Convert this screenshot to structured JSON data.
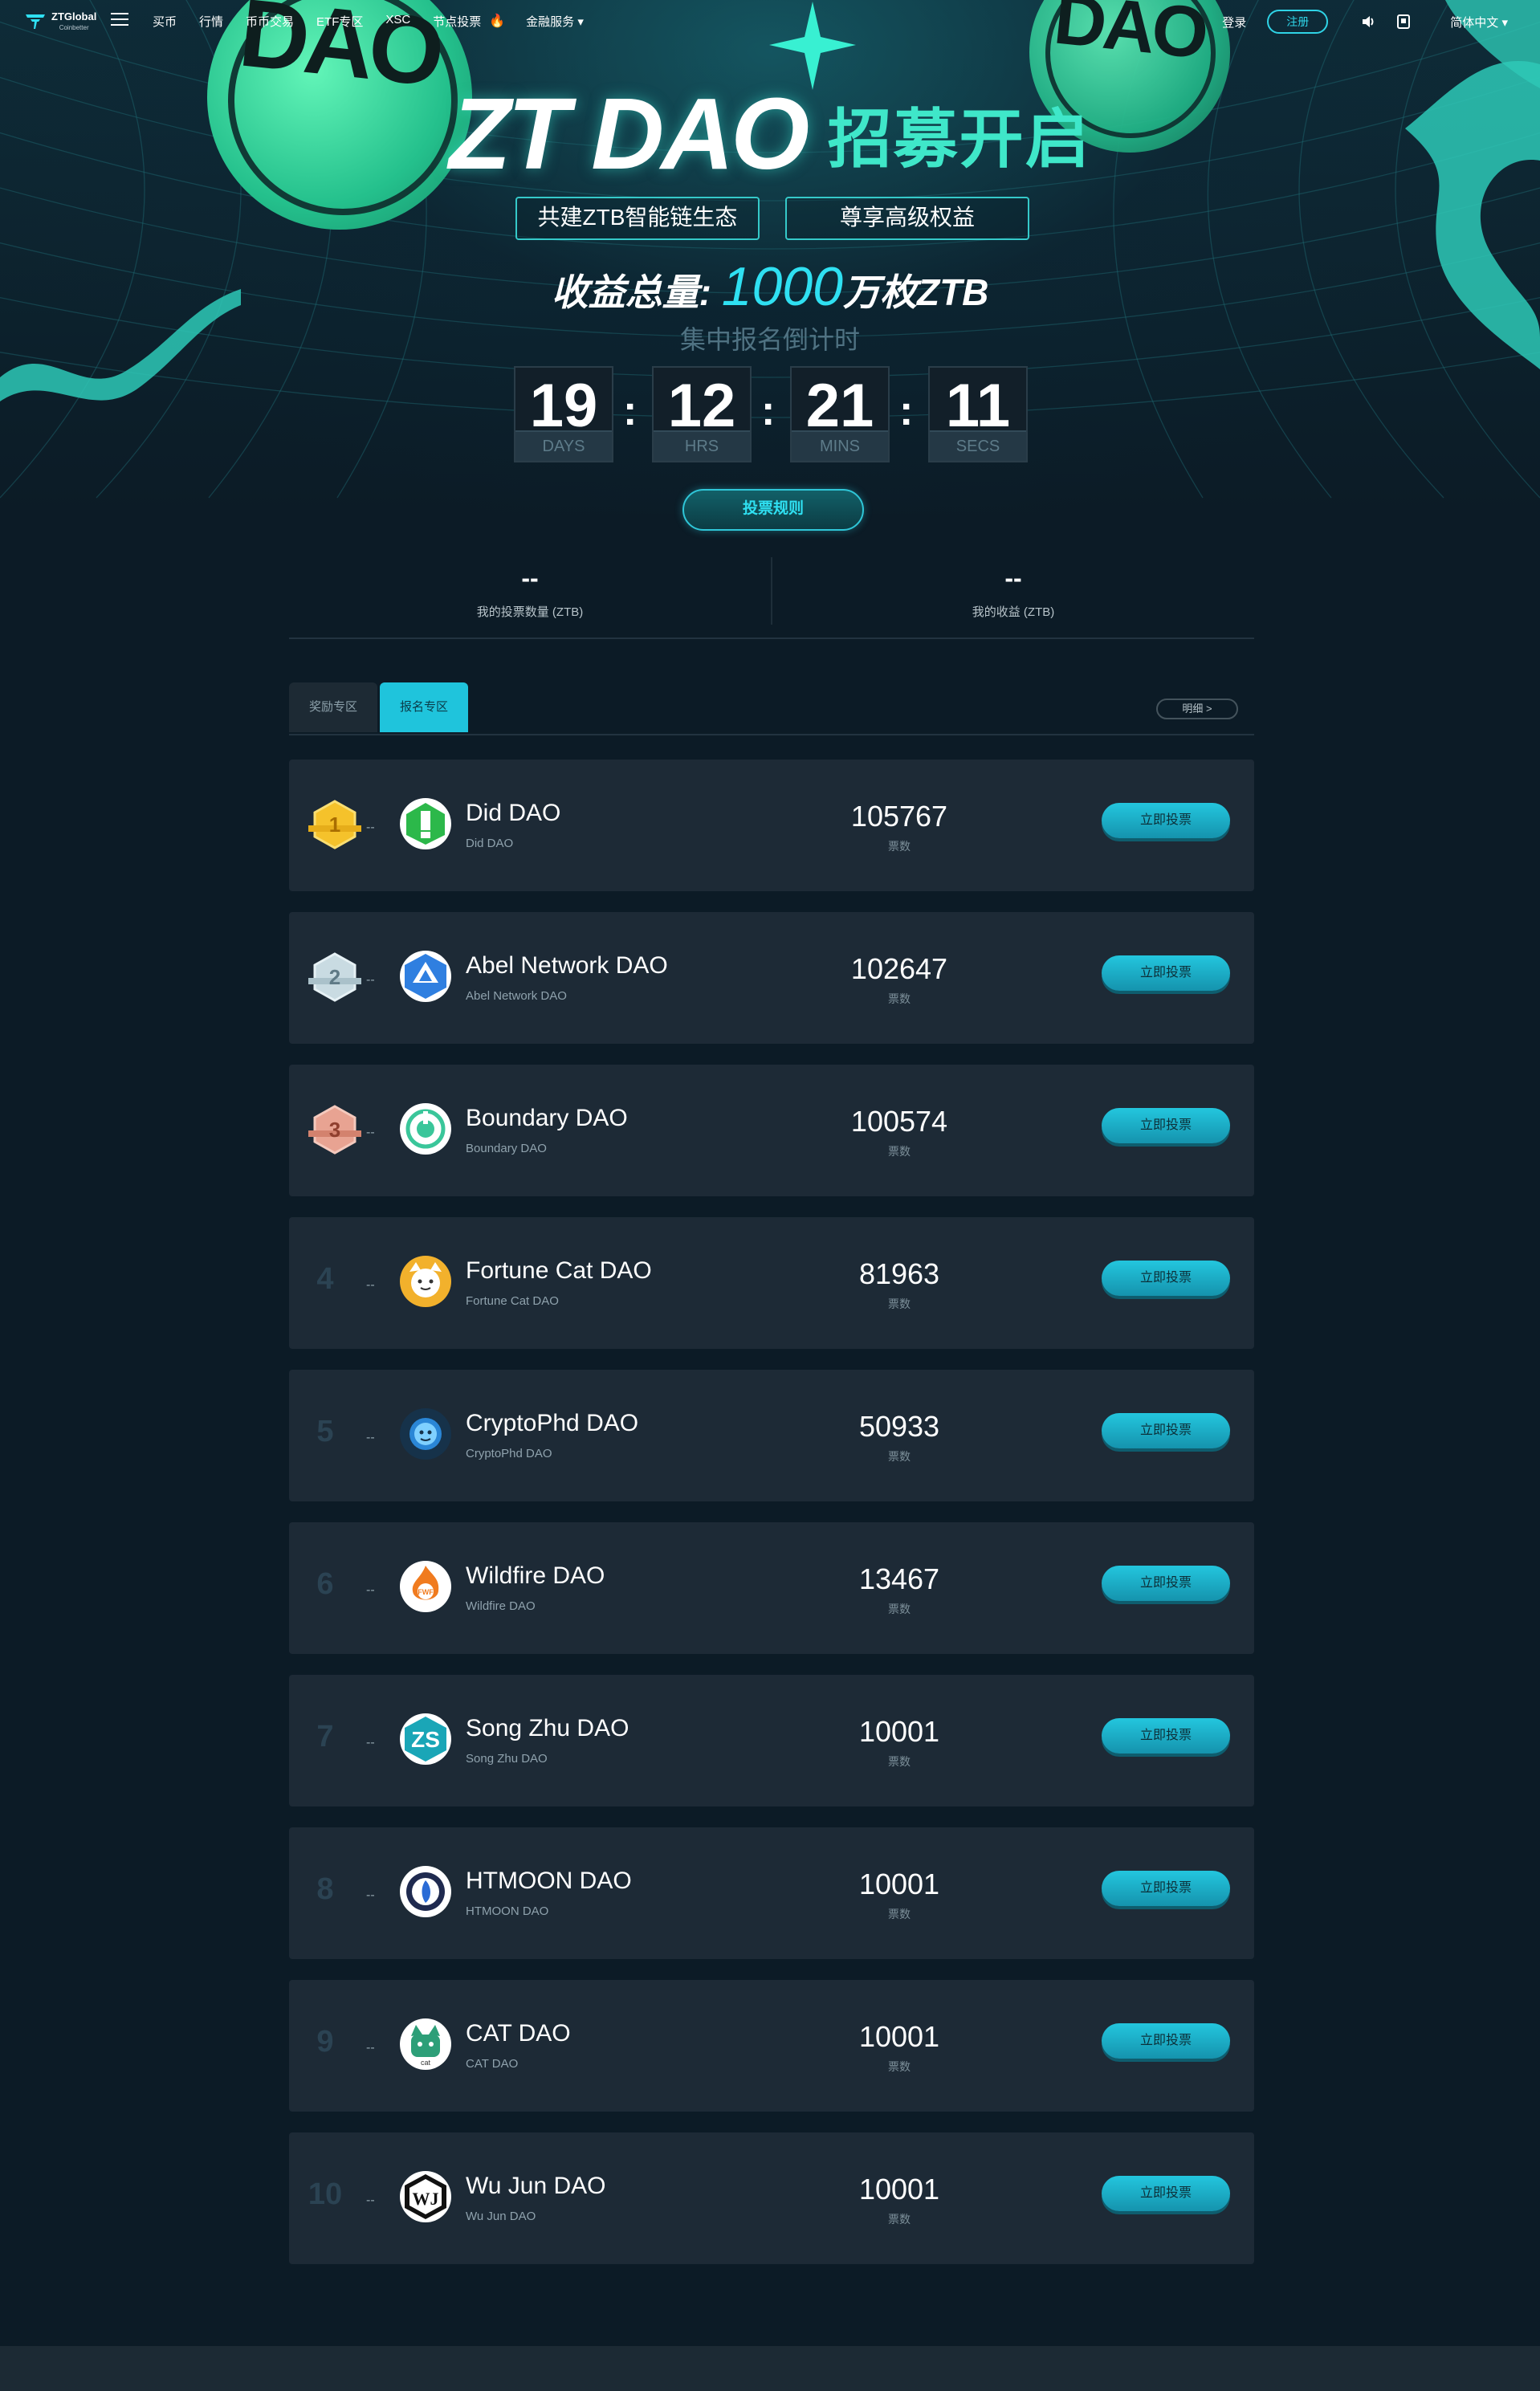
{
  "nav": {
    "logo_text": "ZTGlobal",
    "logo_sub": "Coinbetter",
    "links": [
      "买币",
      "行情",
      "币币交易",
      "ETF专区",
      "XSC",
      "节点投票"
    ],
    "fire_icon": "fire-icon",
    "finance_label": "金融服务",
    "login_label": "登录",
    "register_label": "注册",
    "language_label": "简体中文"
  },
  "hero": {
    "coin_text": "DAO",
    "title_en": "ZT DAO",
    "title_cn": "招募开启",
    "tag1": "共建ZTB智能链生态",
    "tag2": "尊享高级权益",
    "total_prefix": "收益总量:",
    "total_value": "1000",
    "total_suffix": "万枚ZTB",
    "countdown_label": "集中报名倒计时",
    "countdown": [
      {
        "value": "19",
        "unit": "DAYS"
      },
      {
        "value": "12",
        "unit": "HRS"
      },
      {
        "value": "21",
        "unit": "MINS"
      },
      {
        "value": "11",
        "unit": "SECS"
      }
    ],
    "separator": ":",
    "rules_button": "投票规则"
  },
  "stats": {
    "my_votes_value": "--",
    "my_votes_label": "我的投票数量 (ZTB)",
    "my_income_value": "--",
    "my_income_label": "我的收益 (ZTB)"
  },
  "tabs": {
    "items": [
      "奖励专区",
      "报名专区"
    ],
    "active": 1,
    "detail_label": "明细 >"
  },
  "list": {
    "votes_unit": "票数",
    "vote_button": "立即投票",
    "dash": "--",
    "rows": [
      {
        "rank": "1",
        "name": "Did DAO",
        "sub": "Did DAO",
        "votes": "105767",
        "icon": "did-dao-logo-icon"
      },
      {
        "rank": "2",
        "name": "Abel Network DAO",
        "sub": "Abel Network DAO",
        "votes": "102647",
        "icon": "abel-network-logo-icon"
      },
      {
        "rank": "3",
        "name": "Boundary DAO",
        "sub": "Boundary DAO",
        "votes": "100574",
        "icon": "boundary-logo-icon"
      },
      {
        "rank": "4",
        "name": "Fortune Cat DAO",
        "sub": "Fortune Cat DAO",
        "votes": "81963",
        "icon": "fortune-cat-logo-icon"
      },
      {
        "rank": "5",
        "name": "CryptoPhd DAO",
        "sub": "CryptoPhd DAO",
        "votes": "50933",
        "icon": "cryptophd-logo-icon"
      },
      {
        "rank": "6",
        "name": "Wildfire DAO",
        "sub": "Wildfire DAO",
        "votes": "13467",
        "icon": "wildfire-logo-icon"
      },
      {
        "rank": "7",
        "name": "Song Zhu DAO",
        "sub": "Song Zhu DAO",
        "votes": "10001",
        "icon": "song-zhu-logo-icon"
      },
      {
        "rank": "8",
        "name": "HTMOON DAO",
        "sub": "HTMOON DAO",
        "votes": "10001",
        "icon": "htmoon-logo-icon"
      },
      {
        "rank": "9",
        "name": "CAT DAO",
        "sub": "CAT DAO",
        "votes": "10001",
        "icon": "cat-dao-logo-icon"
      },
      {
        "rank": "10",
        "name": "Wu Jun DAO",
        "sub": "Wu Jun DAO",
        "votes": "10001",
        "icon": "wu-jun-logo-icon"
      }
    ]
  },
  "colors": {
    "accent": "#2fe0f2",
    "title_green": "#3fe7c9",
    "row_bg": "#1d2a36",
    "page_bg": "#0c1b26",
    "medal_gold": "#f5c22b",
    "medal_silver": "#c9dbe2",
    "medal_bronze": "#e8a392"
  }
}
